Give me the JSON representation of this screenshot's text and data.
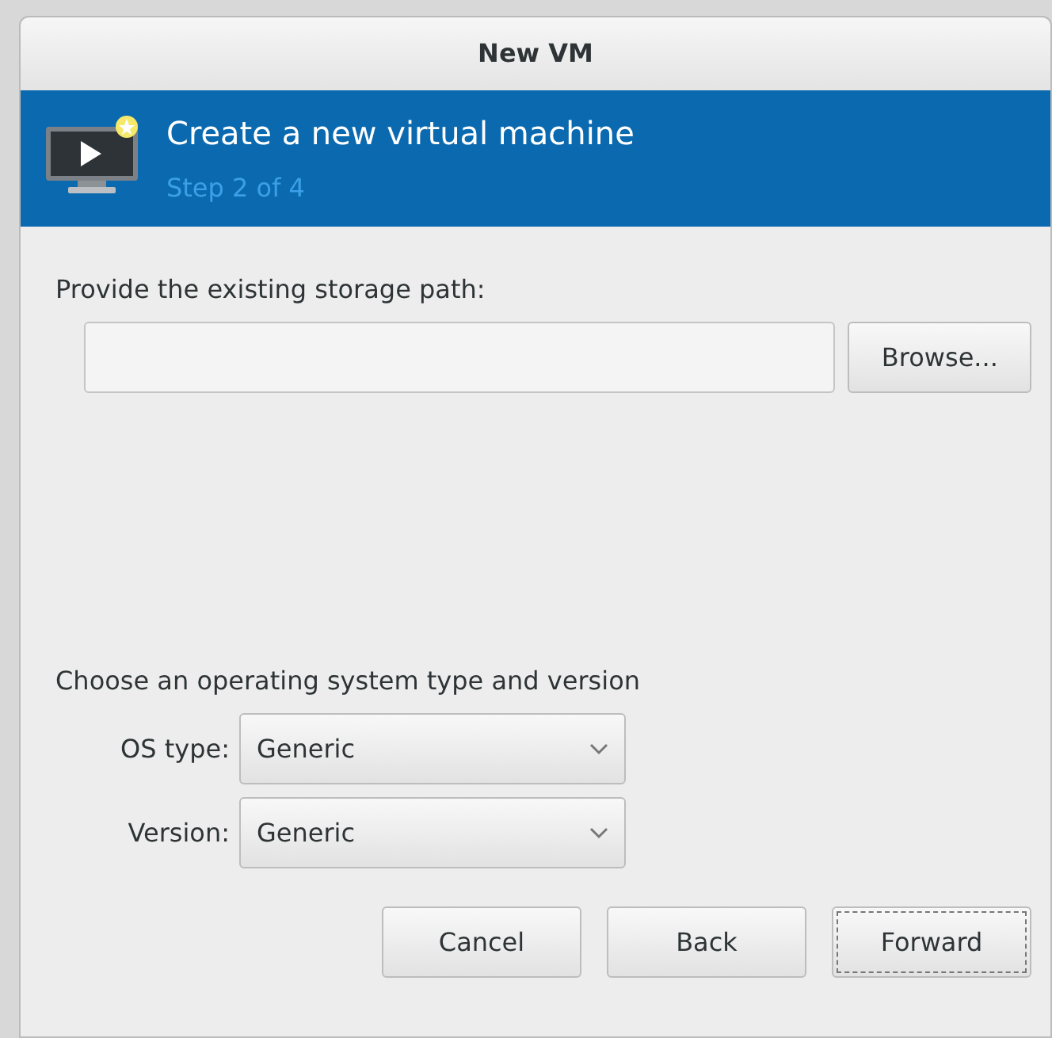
{
  "window": {
    "title": "New VM"
  },
  "header": {
    "title": "Create a new virtual machine",
    "subtitle": "Step 2 of 4"
  },
  "storage": {
    "label": "Provide the existing storage path:",
    "browse_button": "Browse..."
  },
  "os": {
    "heading": "Choose an operating system type and version",
    "fields": [
      {
        "label": "OS type:",
        "value": "Generic"
      },
      {
        "label": "Version:",
        "value": "Generic"
      }
    ]
  },
  "buttons": [
    {
      "label": "Cancel",
      "focused": false
    },
    {
      "label": "Back",
      "focused": false
    },
    {
      "label": "Forward",
      "focused": true
    }
  ]
}
